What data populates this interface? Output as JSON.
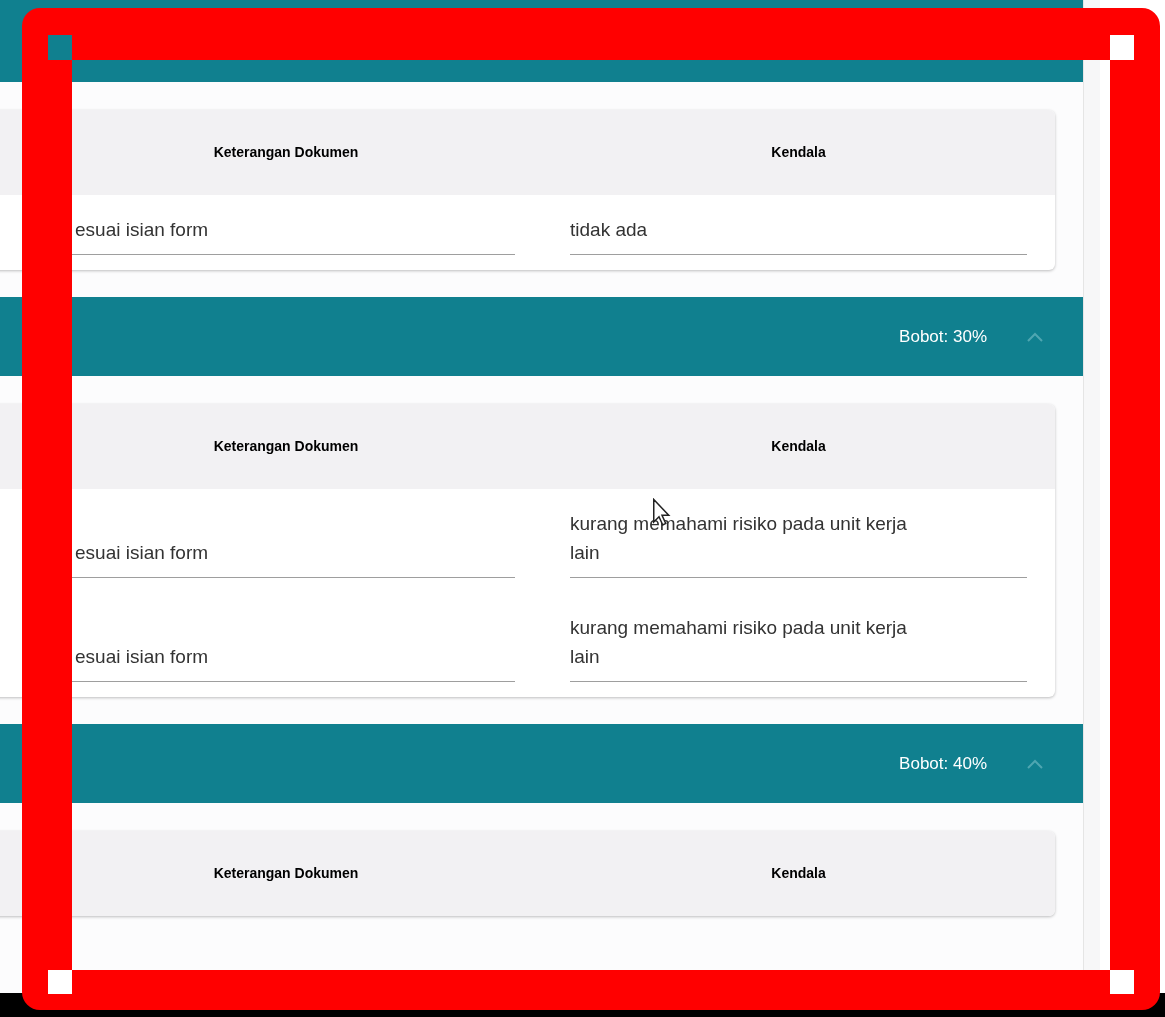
{
  "sections": [
    {
      "columns": [
        "Keterangan Dokumen",
        "Kendala"
      ],
      "rows": [
        {
          "document_note": "esuai isian form",
          "obstacle": "tidak ada"
        }
      ]
    },
    {
      "weight": "Bobot: 30%",
      "expanded": true,
      "columns": [
        "Keterangan Dokumen",
        "Kendala"
      ],
      "rows": [
        {
          "document_note": "esuai isian form",
          "obstacle": "kurang memahami risiko pada unit kerja lain"
        },
        {
          "document_note": "esuai isian form",
          "obstacle": "kurang memahami risiko pada unit kerja lain"
        }
      ]
    },
    {
      "weight": "Bobot: 40%",
      "expanded": true,
      "columns": [
        "Keterangan Dokumen",
        "Kendala"
      ]
    }
  ]
}
